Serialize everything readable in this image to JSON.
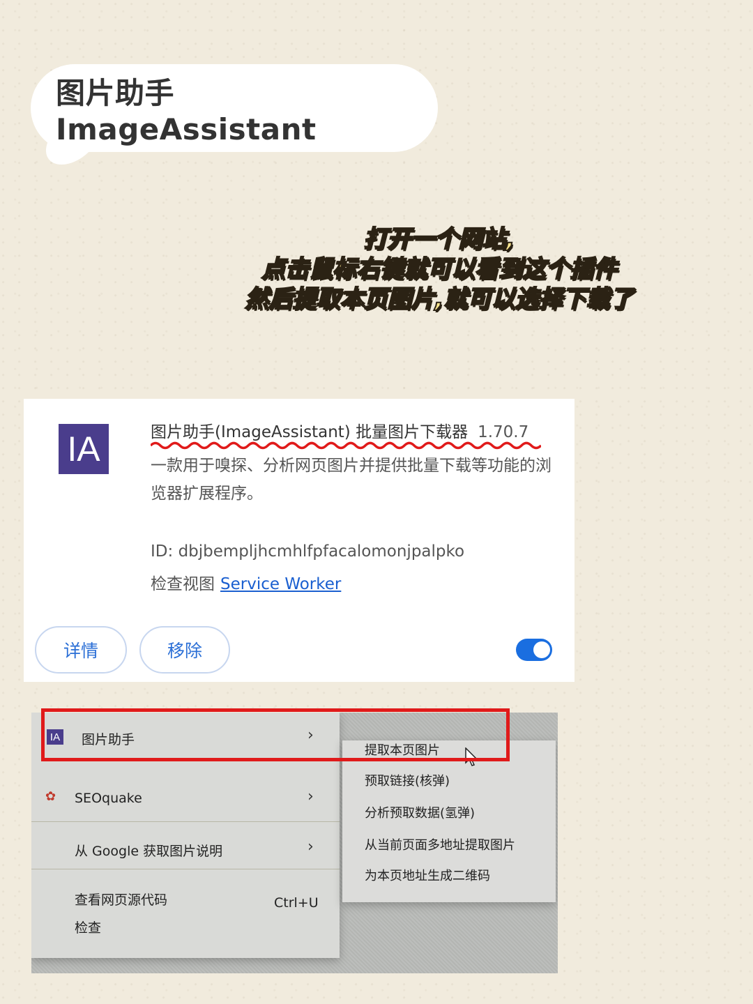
{
  "header": {
    "title": "图片助手 ImageAssistant"
  },
  "instructions": {
    "line1": "打开一个网站,",
    "line2": "点击鼠标右键就可以看到这个插件",
    "line3": "然后提取本页图片,就可以选择下载了"
  },
  "extension_card": {
    "logo_text": "IA",
    "name": "图片助手(ImageAssistant) 批量图片下载器",
    "version": "1.70.7",
    "description": "一款用于嗅探、分析网页图片并提供批量下载等功能的浏览器扩展程序。",
    "id_label": "ID:",
    "id_value": "dbjbempljhcmhlfpfacalomonjpalpko",
    "inspect_label": "检查视图",
    "inspect_link": "Service Worker",
    "details_button": "详情",
    "remove_button": "移除",
    "enabled": true,
    "accent_color": "#1a6ee0"
  },
  "context_menu": {
    "items": [
      {
        "icon": "ia-logo-icon",
        "icon_text": "IA",
        "label": "图片助手",
        "has_submenu": true
      },
      {
        "icon": "seoquake-icon",
        "label": "SEOquake",
        "has_submenu": true
      },
      {
        "label": "从 Google 获取图片说明",
        "has_submenu": true
      },
      {
        "label": "查看网页源代码",
        "shortcut": "Ctrl+U"
      },
      {
        "label": "检查"
      }
    ],
    "submenu": [
      "提取本页图片",
      "预取链接(核弹)",
      "分析预取数据(氢弹)",
      "从当前页面多地址提取图片",
      "为本页地址生成二维码"
    ],
    "highlight_color": "#e01a1a"
  }
}
